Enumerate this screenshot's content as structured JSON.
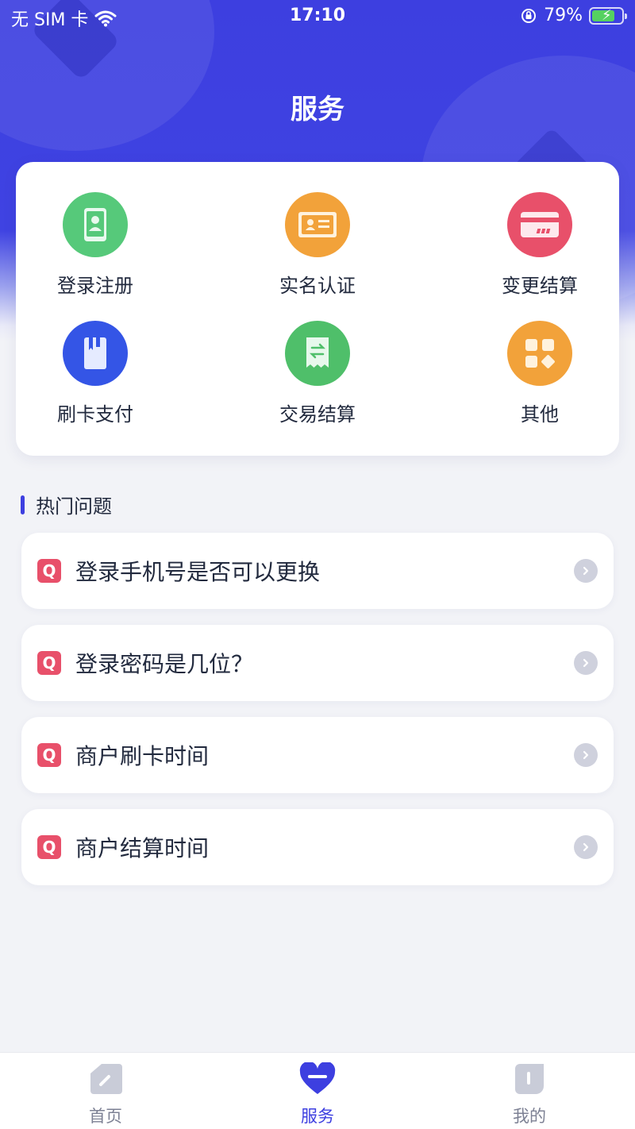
{
  "status_bar": {
    "carrier": "无 SIM 卡",
    "time": "17:10",
    "battery_percent": "79%",
    "battery_level": 0.79,
    "icons": [
      "wifi-icon",
      "orientation-lock-icon",
      "battery-charging-icon"
    ]
  },
  "header": {
    "title": "服务"
  },
  "services": [
    {
      "label": "登录注册",
      "icon": "phone-user-icon",
      "color": "#56c97a"
    },
    {
      "label": "实名认证",
      "icon": "id-card-icon",
      "color": "#f2a23a"
    },
    {
      "label": "变更结算",
      "icon": "bank-card-icon",
      "color": "#e8506a"
    },
    {
      "label": "刷卡支付",
      "icon": "card-pay-icon",
      "color": "#3455e6"
    },
    {
      "label": "交易结算",
      "icon": "receipt-exchange-icon",
      "color": "#4fbf6a"
    },
    {
      "label": "其他",
      "icon": "grid-apps-icon",
      "color": "#f2a23a"
    }
  ],
  "faq": {
    "title": "热门问题",
    "badge": "Q",
    "items": [
      {
        "question": "登录手机号是否可以更换"
      },
      {
        "question": "登录密码是几位？"
      },
      {
        "question": "商户刷卡时间"
      },
      {
        "question": "商户结算时间"
      }
    ]
  },
  "tabbar": {
    "items": [
      {
        "label": "首页",
        "icon": "home-icon",
        "active": false
      },
      {
        "label": "服务",
        "icon": "heart-icon",
        "active": true
      },
      {
        "label": "我的",
        "icon": "profile-icon",
        "active": false
      }
    ]
  },
  "colors": {
    "primary": "#3d3fe0",
    "badge": "#e8506a"
  }
}
